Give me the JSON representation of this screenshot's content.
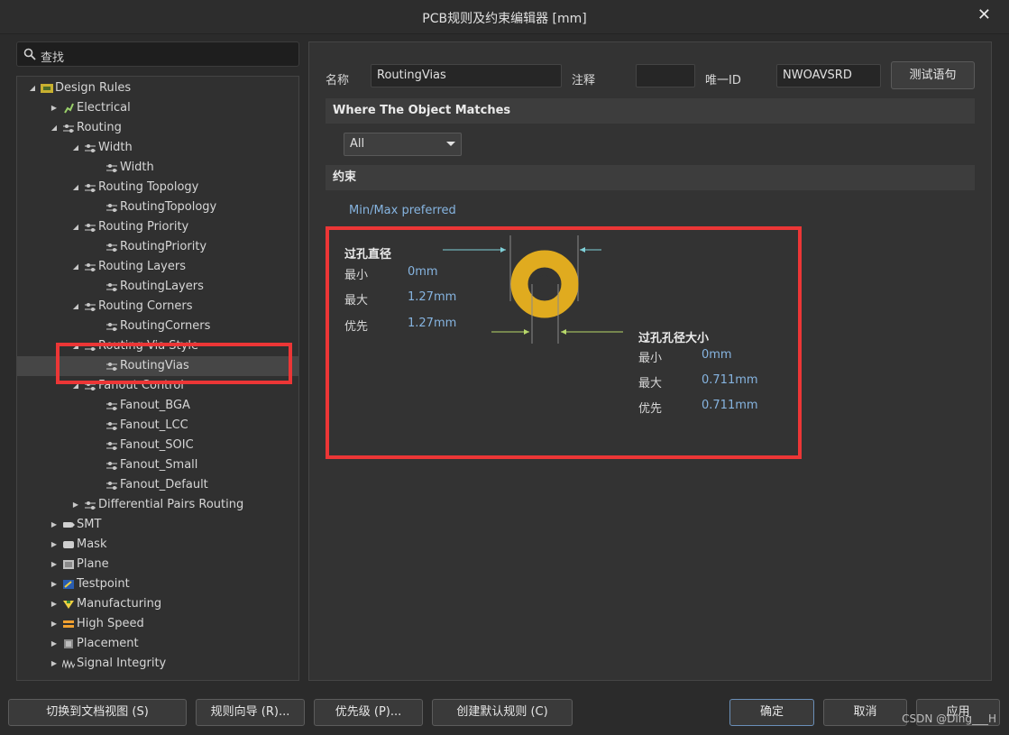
{
  "window": {
    "title": "PCB规则及约束编辑器 [mm]",
    "close_glyph": "✕"
  },
  "search": {
    "placeholder": "查找"
  },
  "tree": [
    {
      "label": "Design Rules",
      "indent": 0,
      "arrow": "▲",
      "icon": "design-rules-icon"
    },
    {
      "label": "Electrical",
      "indent": 1,
      "arrow": "▶",
      "icon": "electrical-icon"
    },
    {
      "label": "Routing",
      "indent": 1,
      "arrow": "▲",
      "icon": "rule-icon"
    },
    {
      "label": "Width",
      "indent": 2,
      "arrow": "▲",
      "icon": "rule-icon"
    },
    {
      "label": "Width",
      "indent": 3,
      "arrow": "",
      "icon": "rule-icon"
    },
    {
      "label": "Routing Topology",
      "indent": 2,
      "arrow": "▲",
      "icon": "rule-icon"
    },
    {
      "label": "RoutingTopology",
      "indent": 3,
      "arrow": "",
      "icon": "rule-icon"
    },
    {
      "label": "Routing Priority",
      "indent": 2,
      "arrow": "▲",
      "icon": "rule-icon"
    },
    {
      "label": "RoutingPriority",
      "indent": 3,
      "arrow": "",
      "icon": "rule-icon"
    },
    {
      "label": "Routing Layers",
      "indent": 2,
      "arrow": "▲",
      "icon": "rule-icon"
    },
    {
      "label": "RoutingLayers",
      "indent": 3,
      "arrow": "",
      "icon": "rule-icon"
    },
    {
      "label": "Routing Corners",
      "indent": 2,
      "arrow": "▲",
      "icon": "rule-icon"
    },
    {
      "label": "RoutingCorners",
      "indent": 3,
      "arrow": "",
      "icon": "rule-icon"
    },
    {
      "label": "Routing Via Style",
      "indent": 2,
      "arrow": "▲",
      "icon": "rule-icon"
    },
    {
      "label": "RoutingVias",
      "indent": 3,
      "arrow": "",
      "icon": "rule-icon",
      "selected": true
    },
    {
      "label": "Fanout Control",
      "indent": 2,
      "arrow": "▲",
      "icon": "rule-icon"
    },
    {
      "label": "Fanout_BGA",
      "indent": 3,
      "arrow": "",
      "icon": "rule-icon"
    },
    {
      "label": "Fanout_LCC",
      "indent": 3,
      "arrow": "",
      "icon": "rule-icon"
    },
    {
      "label": "Fanout_SOIC",
      "indent": 3,
      "arrow": "",
      "icon": "rule-icon"
    },
    {
      "label": "Fanout_Small",
      "indent": 3,
      "arrow": "",
      "icon": "rule-icon"
    },
    {
      "label": "Fanout_Default",
      "indent": 3,
      "arrow": "",
      "icon": "rule-icon"
    },
    {
      "label": "Differential Pairs Routing",
      "indent": 2,
      "arrow": "▶",
      "icon": "rule-icon"
    },
    {
      "label": "SMT",
      "indent": 1,
      "arrow": "▶",
      "icon": "smt-icon"
    },
    {
      "label": "Mask",
      "indent": 1,
      "arrow": "▶",
      "icon": "mask-icon"
    },
    {
      "label": "Plane",
      "indent": 1,
      "arrow": "▶",
      "icon": "plane-icon"
    },
    {
      "label": "Testpoint",
      "indent": 1,
      "arrow": "▶",
      "icon": "testpoint-icon"
    },
    {
      "label": "Manufacturing",
      "indent": 1,
      "arrow": "▶",
      "icon": "manufacturing-icon"
    },
    {
      "label": "High Speed",
      "indent": 1,
      "arrow": "▶",
      "icon": "high-speed-icon"
    },
    {
      "label": "Placement",
      "indent": 1,
      "arrow": "▶",
      "icon": "placement-icon"
    },
    {
      "label": "Signal Integrity",
      "indent": 1,
      "arrow": "▶",
      "icon": "signal-integrity-icon"
    }
  ],
  "rule": {
    "name_label": "名称",
    "name_value": "RoutingVias",
    "comment_label": "注释",
    "comment_value": "",
    "uid_label": "唯一ID",
    "uid_value": "NWOAVSRD",
    "test_button": "测试语句"
  },
  "where": {
    "header": "Where The Object Matches",
    "selected": "All"
  },
  "constraints": {
    "header": "约束",
    "mode": "Min/Max preferred",
    "via_diameter": {
      "title": "过孔直径",
      "min_label": "最小",
      "min_value": "0mm",
      "max_label": "最大",
      "max_value": "1.27mm",
      "pref_label": "优先",
      "pref_value": "1.27mm"
    },
    "hole_size": {
      "title": "过孔孔径大小",
      "min_label": "最小",
      "min_value": "0mm",
      "max_label": "最大",
      "max_value": "0.711mm",
      "pref_label": "优先",
      "pref_value": "0.711mm"
    }
  },
  "footer": {
    "doc_view": "切换到文档视图 (S)",
    "rule_wizard": "规则向导 (R)...",
    "priority": "优先级 (P)...",
    "create_default": "创建默认规则 (C)",
    "ok": "确定",
    "cancel": "取消",
    "apply": "应用"
  },
  "watermark": "CSDN @Ding___H",
  "colors": {
    "highlight": "#ec3636",
    "via_pad": "#e0ab1f",
    "value_text": "#86b4e0"
  }
}
